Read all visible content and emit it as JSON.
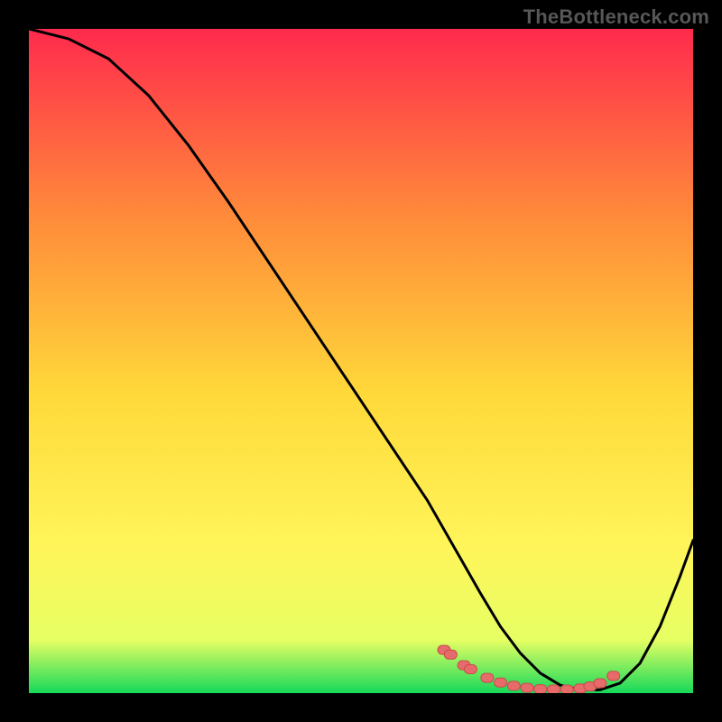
{
  "watermark": "TheBottleneck.com",
  "colors": {
    "frame": "#000000",
    "watermark": "#575757",
    "curve": "#000000",
    "marker_fill": "#e86b6b",
    "marker_stroke": "#c94c4c",
    "gradient_top": "#ff2a4d",
    "gradient_mid_upper": "#ff8a3a",
    "gradient_mid": "#ffd93a",
    "gradient_mid_lower": "#fff55a",
    "gradient_low": "#e6ff63",
    "gradient_bottom": "#16d95a"
  },
  "chart_data": {
    "type": "line",
    "title": "",
    "xlabel": "",
    "ylabel": "",
    "xlim": [
      0,
      100
    ],
    "ylim": [
      0,
      100
    ],
    "series": [
      {
        "name": "bottleneck-curve",
        "x": [
          0,
          6,
          12,
          18,
          24,
          30,
          36,
          42,
          48,
          54,
          60,
          64,
          68,
          71,
          74,
          77,
          80,
          83,
          86,
          89,
          92,
          95,
          98,
          100
        ],
        "y": [
          100,
          98.5,
          95.5,
          90,
          82.5,
          74,
          65,
          56,
          47,
          38,
          29,
          22,
          15,
          10,
          6,
          3,
          1.2,
          0.5,
          0.5,
          1.5,
          4.5,
          10,
          17.5,
          23
        ]
      }
    ],
    "markers": {
      "name": "highlighted-points",
      "x": [
        62.5,
        63.5,
        65.5,
        66.5,
        69,
        71,
        73,
        75,
        77,
        79,
        81,
        83,
        84.5,
        86,
        88
      ],
      "y": [
        6.5,
        5.8,
        4.2,
        3.6,
        2.3,
        1.6,
        1.1,
        0.8,
        0.6,
        0.55,
        0.55,
        0.7,
        1.0,
        1.5,
        2.6
      ]
    }
  }
}
